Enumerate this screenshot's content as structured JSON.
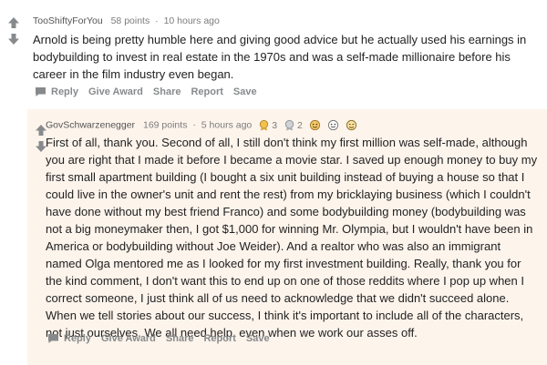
{
  "comment1": {
    "username": "TooShiftyForYou",
    "points": "58 points",
    "separator": "·",
    "time": "10 hours ago",
    "body": "Arnold is being pretty humble here and giving good advice but he actually used his earnings in bodybuilding to invest in real estate in the 1970s and was a self-made millionaire before his career in the film industry even began.",
    "actions": {
      "reply": "Reply",
      "give_award": "Give Award",
      "share": "Share",
      "report": "Report",
      "save": "Save"
    }
  },
  "comment2": {
    "username": "GovSchwarzenegger",
    "points": "169 points",
    "separator": "·",
    "time": "5 hours ago",
    "awards": [
      {
        "icon": "gold-award-icon",
        "count": "3"
      },
      {
        "icon": "silver-award-icon",
        "count": "2"
      },
      {
        "icon": "award-icon-3",
        "count": ""
      },
      {
        "icon": "award-icon-4",
        "count": ""
      },
      {
        "icon": "award-icon-5",
        "count": ""
      }
    ],
    "body": "First of all, thank you. Second of all, I still don't think my first million was self-made, although you are right that I made it before I became a movie star. I saved up enough money to buy my first small apartment building (I bought a six unit building instead of buying a house so that I could live in the owner's unit and rent the rest) from my bricklaying business (which I couldn't have done without my best friend Franco) and some bodybuilding money (bodybuilding was not a big moneymaker then, I got $1,000 for winning Mr. Olympia, but I wouldn't have been in America or bodybuilding without Joe Weider). And a realtor who was also an immigrant named Olga mentored me as I looked for my first investment building. Really, thank you for the kind comment, I don't want this to end up on one of those reddits where I pop up when I correct someone, I just think all of us need to acknowledge that we didn't succeed alone. When we tell stories about our success, I think it's important to include all of the characters, not just ourselves. We all need help, even when we work our asses off.",
    "actions": {
      "reply": "Reply",
      "give_award": "Give Award",
      "share": "Share",
      "report": "Report",
      "save": "Save"
    }
  },
  "colors": {
    "upvote": "#878a8c",
    "highlight_background": "#fdf4ec",
    "meta_text": "#7c7c7c",
    "action_text": "#878a8c"
  }
}
